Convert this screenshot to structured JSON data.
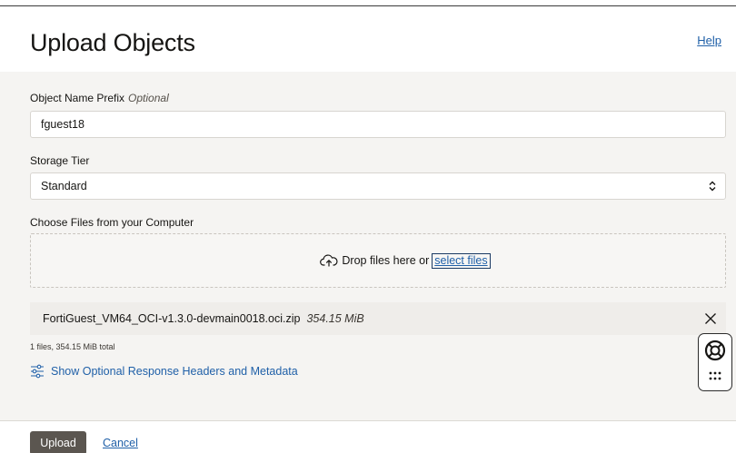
{
  "header": {
    "title": "Upload Objects",
    "help_label": "Help"
  },
  "form": {
    "prefix": {
      "label": "Object Name Prefix",
      "optional_hint": "Optional",
      "value": "fguest18"
    },
    "storage_tier": {
      "label": "Storage Tier",
      "selected": "Standard"
    },
    "files": {
      "label": "Choose Files from your Computer",
      "drop_text": "Drop files here or",
      "select_link": "select files",
      "items": [
        {
          "name": "FortiGuest_VM64_OCI-v1.3.0-devmain0018.oci.zip",
          "size": "354.15 MiB"
        }
      ],
      "summary": "1 files, 354.15 MiB total"
    },
    "optional_headers_link": "Show Optional Response Headers and Metadata"
  },
  "footer": {
    "upload_label": "Upload",
    "cancel_label": "Cancel"
  },
  "colors": {
    "link": "#2060a8",
    "primary_button": "#5b5650",
    "panel_background": "#f5f4f2"
  },
  "icons": [
    "cloud-upload-icon",
    "close-icon",
    "sliders-icon",
    "lifebuoy-icon",
    "grid-dots-icon",
    "chevron-updown-icon"
  ]
}
